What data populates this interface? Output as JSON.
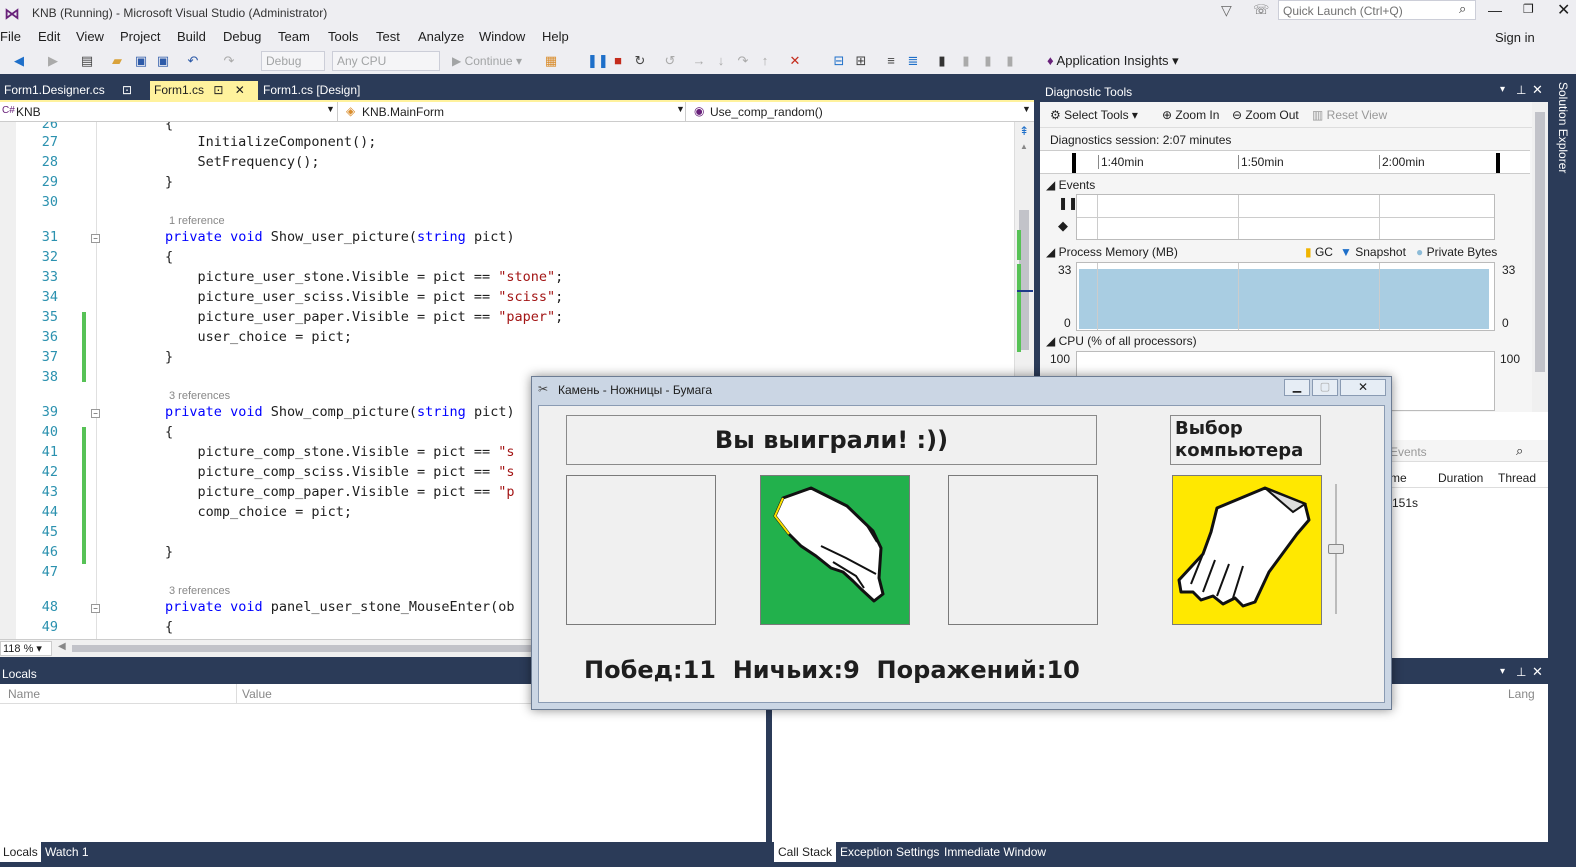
{
  "window": {
    "title": "KNB (Running) - Microsoft Visual Studio (Administrator)",
    "quick_launch_placeholder": "Quick Launch (Ctrl+Q)",
    "sign_in": "Sign in"
  },
  "menu": [
    "File",
    "Edit",
    "View",
    "Project",
    "Build",
    "Debug",
    "Team",
    "Tools",
    "Test",
    "Analyze",
    "Window",
    "Help"
  ],
  "toolbar": {
    "config": "Debug",
    "platform": "Any CPU",
    "continue": "Continue",
    "app_insights": "Application Insights"
  },
  "tabs": [
    {
      "label": "Form1.Designer.cs"
    },
    {
      "label": "Form1.cs"
    },
    {
      "label": "Form1.cs [Design]"
    }
  ],
  "nav": {
    "project": "KNB",
    "class": "KNB.MainForm",
    "member": "Use_comp_random()"
  },
  "editor": {
    "zoom": "118 %",
    "lines": [
      {
        "n": "26",
        "code": "        {"
      },
      {
        "n": "27",
        "code": "            InitializeComponent();"
      },
      {
        "n": "28",
        "code": "            SetFrequency();"
      },
      {
        "n": "29",
        "code": "        }"
      },
      {
        "n": "30",
        "code": ""
      },
      {
        "n": "31",
        "code": "        private void Show_user_picture(string pict)"
      },
      {
        "n": "32",
        "code": "        {"
      },
      {
        "n": "33",
        "code": "            picture_user_stone.Visible = pict == \"stone\";"
      },
      {
        "n": "34",
        "code": "            picture_user_sciss.Visible = pict == \"sciss\";"
      },
      {
        "n": "35",
        "code": "            picture_user_paper.Visible = pict == \"paper\";"
      },
      {
        "n": "36",
        "code": "            user_choice = pict;"
      },
      {
        "n": "37",
        "code": "        }"
      },
      {
        "n": "38",
        "code": ""
      },
      {
        "n": "39",
        "code": "        private void Show_comp_picture(string pict)"
      },
      {
        "n": "40",
        "code": "        {"
      },
      {
        "n": "41",
        "code": "            picture_comp_stone.Visible = pict == \"s"
      },
      {
        "n": "42",
        "code": "            picture_comp_sciss.Visible = pict == \"s"
      },
      {
        "n": "43",
        "code": "            picture_comp_paper.Visible = pict == \"p"
      },
      {
        "n": "44",
        "code": "            comp_choice = pict;"
      },
      {
        "n": "45",
        "code": ""
      },
      {
        "n": "46",
        "code": "        }"
      },
      {
        "n": "47",
        "code": ""
      },
      {
        "n": "48",
        "code": "        private void panel_user_stone_MouseEnter(ob"
      },
      {
        "n": "49",
        "code": "        {"
      }
    ],
    "refs": [
      "1 reference",
      "3 references",
      "3 references"
    ]
  },
  "diag": {
    "title": "Diagnostic Tools",
    "select_tools": "Select Tools",
    "zoom_in": "Zoom In",
    "zoom_out": "Zoom Out",
    "reset_view": "Reset View",
    "session": "Diagnostics session: 2:07 minutes",
    "ticks": [
      "1:40min",
      "1:50min",
      "2:00min"
    ],
    "events": "Events",
    "memory": "Process Memory (MB)",
    "gc": "GC",
    "snapshot": "Snapshot",
    "private_bytes": "Private Bytes",
    "mem_max": "33",
    "mem_min": "0",
    "cpu": "CPU (% of all processors)",
    "cpu_max": "100",
    "events_search": "Events",
    "columns": [
      "me",
      "Duration",
      "Thread"
    ],
    "row_frag": "151s"
  },
  "locals": {
    "title": "Locals",
    "col_name": "Name",
    "col_value": "Value",
    "col_lang": "Lang"
  },
  "bottom_tabs_left": [
    "Locals",
    "Watch 1"
  ],
  "bottom_tabs_right": [
    "Call Stack",
    "Exception Settings",
    "Immediate Window"
  ],
  "sidebar_label": "Solution Explorer",
  "game": {
    "title": "Камень - Ножницы - Бумага",
    "result": "Вы выиграли! :))",
    "comp_label": "Выбор компьютера",
    "score": "Побед:11  Ничьих:9  Поражений:10",
    "colors": {
      "user_pick_bg": "#22b14c",
      "comp_pick_bg": "#ffe800"
    },
    "user_pick_icon": "scissors-hand-icon",
    "comp_pick_icon": "paper-hand-icon"
  }
}
